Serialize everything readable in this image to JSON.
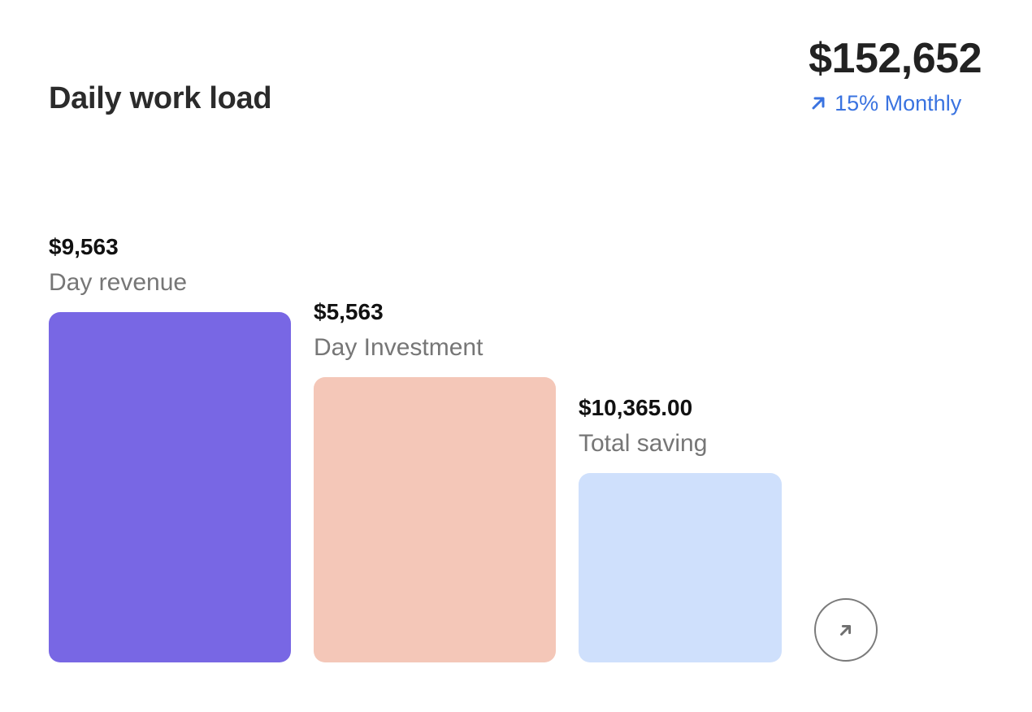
{
  "card": {
    "title": "Daily work load"
  },
  "summary": {
    "total": "$152,652",
    "change": "15% Monthly",
    "change_icon": "arrow-up-right-icon",
    "change_color": "#3a73e0"
  },
  "chart_data": {
    "type": "bar",
    "categories": [
      "Day revenue",
      "Day Investment",
      "Total saving"
    ],
    "value_labels": [
      "$9,563",
      "$5,563",
      "$10,365.00"
    ],
    "values": [
      9563,
      5563,
      10365
    ],
    "relative_heights": [
      1.0,
      0.814,
      0.54
    ],
    "colors": [
      "#7867e4",
      "#f4c7b8",
      "#cfe0fc"
    ],
    "title": "",
    "xlabel": "",
    "ylabel": "",
    "grid": false
  },
  "actions": {
    "expand_icon": "arrow-up-right-icon"
  }
}
